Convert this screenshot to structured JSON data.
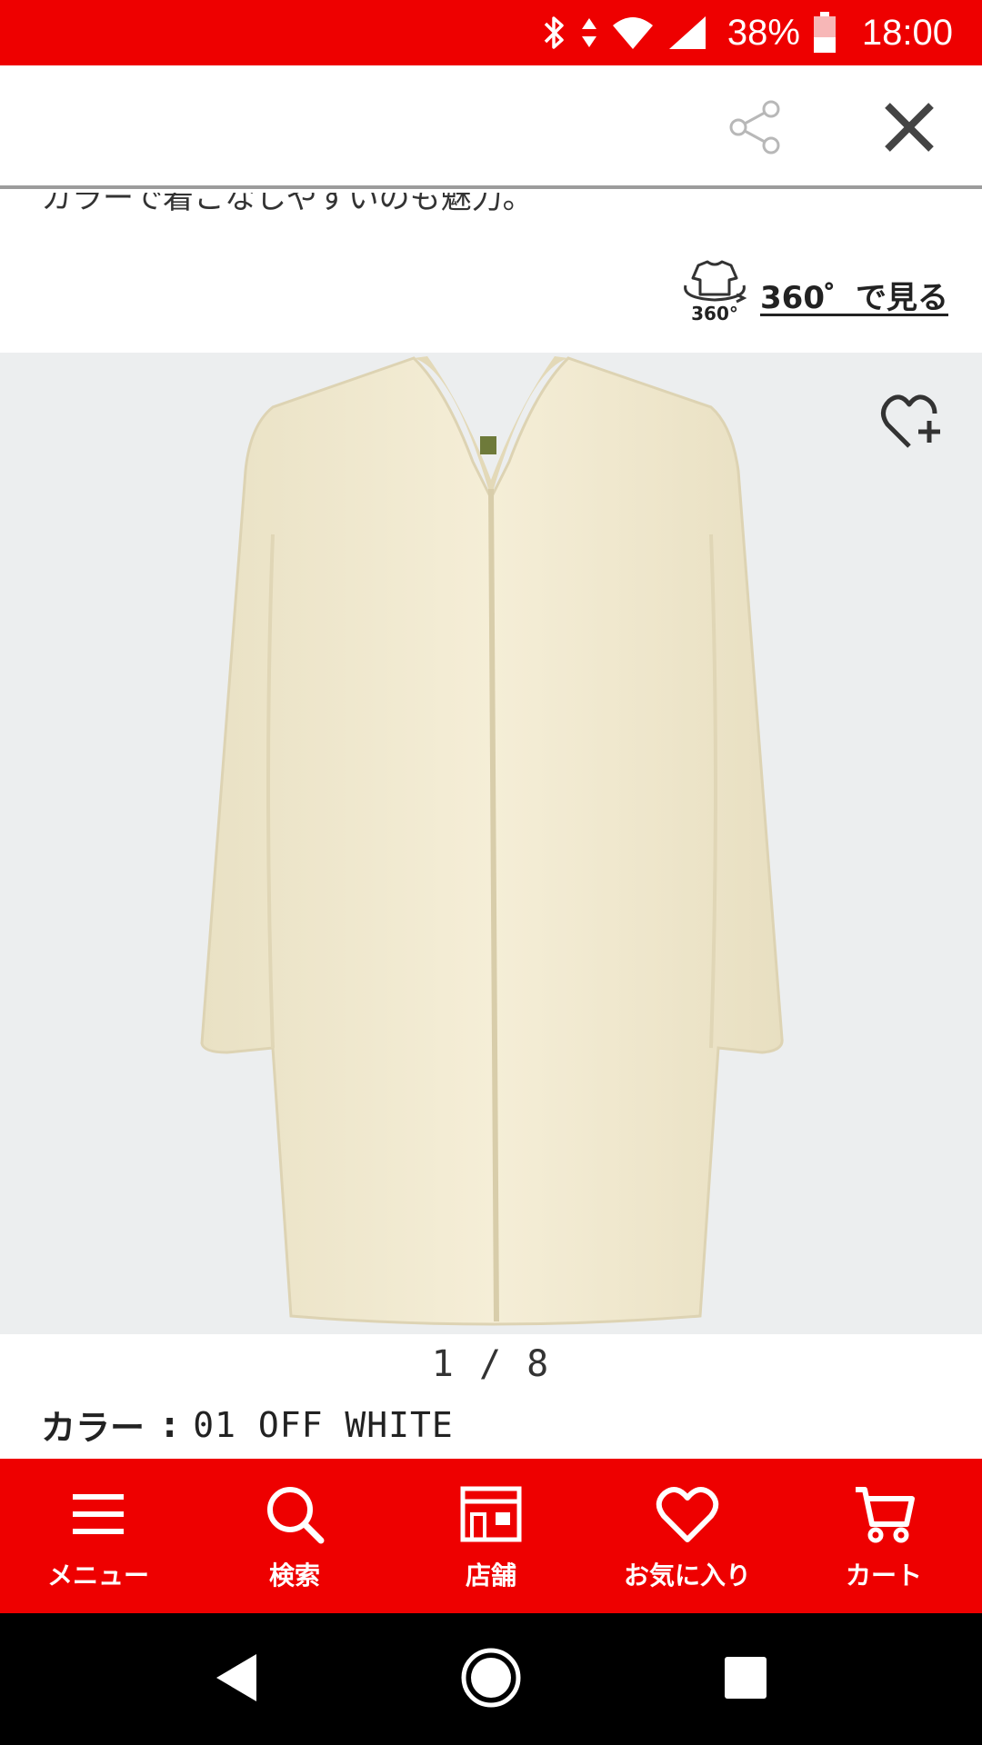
{
  "status_bar": {
    "battery_percent": "38%",
    "time": "18:00",
    "icons": [
      "bluetooth-icon",
      "data-arrows-icon",
      "wifi-icon",
      "cell-signal-icon",
      "battery-icon"
    ]
  },
  "header": {
    "share_icon": "share-icon",
    "close_icon": "close-icon"
  },
  "description_cutoff": "カラーで着こなしやすいのも魅力。",
  "view360": {
    "icon_caption": "360°",
    "label": "360゜で見る"
  },
  "product": {
    "image_alt": "coat",
    "wishlist_icon": "heart-plus-icon",
    "pager": "1 / 8",
    "color_label": "カラー",
    "color_separator": ":",
    "color_value": "01 OFF WHITE"
  },
  "bottom_nav": [
    {
      "label": "メニュー",
      "icon": "menu-icon"
    },
    {
      "label": "検索",
      "icon": "search-icon"
    },
    {
      "label": "店舗",
      "icon": "store-icon"
    },
    {
      "label": "お気に入り",
      "icon": "heart-icon"
    },
    {
      "label": "カート",
      "icon": "cart-icon"
    }
  ],
  "colors": {
    "brand_red": "#ee0000",
    "image_bg": "#eceeef",
    "coat_color": "#f3ecd3"
  }
}
